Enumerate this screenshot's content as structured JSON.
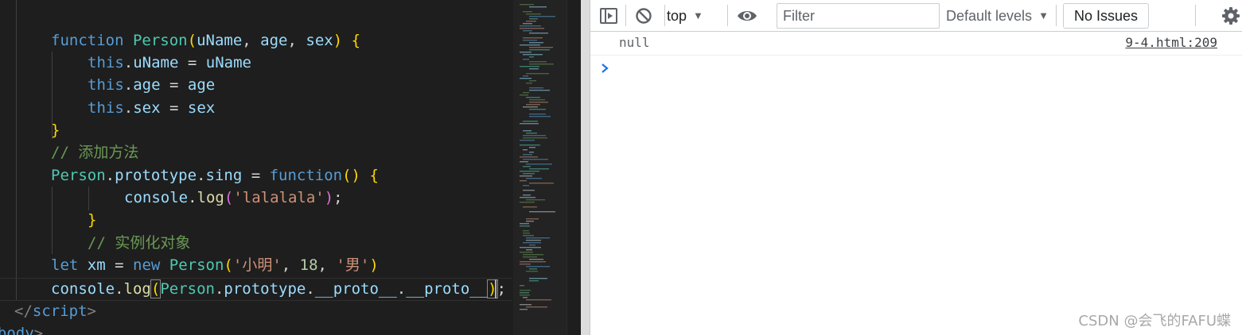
{
  "editor": {
    "code_lines": {
      "l1": {
        "kw": "function",
        "name": "Person",
        "open": "(",
        "p1": "uName",
        "c1": ", ",
        "p2": "age",
        "c2": ", ",
        "p3": "sex",
        "close": ")",
        "sp": " ",
        "brace": "{"
      },
      "l2": {
        "this": "this",
        "dot": ".",
        "prop": "uName",
        "eq": " = ",
        "val": "uName"
      },
      "l3": {
        "this": "this",
        "dot": ".",
        "prop": "age",
        "eq": " = ",
        "val": "age"
      },
      "l4": {
        "this": "this",
        "dot": ".",
        "prop": "sex",
        "eq": " = ",
        "val": "sex"
      },
      "l5": {
        "brace": "}"
      },
      "l6": {
        "comment": "// 添加方法"
      },
      "l7": {
        "cls": "Person",
        "dot1": ".",
        "proto": "prototype",
        "dot2": ".",
        "method": "sing",
        "eq": " = ",
        "kw": "function",
        "paren": "()",
        "sp": " ",
        "brace": "{"
      },
      "l8": {
        "obj": "console",
        "dot": ".",
        "fn": "log",
        "open": "(",
        "str": "'lalalala'",
        "close": ")",
        "semi": ";"
      },
      "l9": {
        "brace": "}"
      },
      "l10": {
        "comment": "// 实例化对象"
      },
      "l11": {
        "kw1": "let",
        "sp1": " ",
        "var": "xm",
        "eq": " = ",
        "kw2": "new",
        "sp2": " ",
        "cls": "Person",
        "open": "(",
        "s1": "'小明'",
        "c1": ", ",
        "num": "18",
        "c2": ", ",
        "s2": "'男'",
        "close": ")"
      },
      "l12": {
        "obj": "console",
        "dot": ".",
        "fn": "log",
        "open": "(",
        "cls": "Person",
        "dot1": ".",
        "proto": "prototype",
        "dot2": ".",
        "p1": "__proto__",
        "dot3": ".",
        "p2": "__proto__",
        "close": ")",
        "semi": ";"
      },
      "l13": {
        "lt": "</",
        "tag": "script",
        "gt": ">"
      },
      "l14": {
        "lt": "</",
        "tag": "body",
        "gt": ">"
      }
    }
  },
  "devtools": {
    "toolbar": {
      "sidebar_icon": "sidebar-toggle-icon",
      "clear_icon": "clear-console-icon",
      "context_label": "top",
      "context_arrow": "▼",
      "eye_icon": "eye-icon",
      "filter_placeholder": "Filter",
      "levels_label": "Default levels",
      "levels_arrow": "▼",
      "issues_label": "No Issues",
      "settings_icon": "gear-icon"
    },
    "messages": [
      {
        "text": "null",
        "source": "9-4.html:209"
      }
    ],
    "prompt_icon": "chevron-right-icon"
  },
  "watermark": "CSDN @会飞的FAFU蝶",
  "colors": {
    "editor_bg": "#1e1e1e",
    "keyword": "#569cd6",
    "function": "#dcdcaa",
    "class": "#4ec9b0",
    "variable": "#9cdcfe",
    "string": "#ce9178",
    "number": "#b5cea8",
    "comment": "#6a9955",
    "prompt_accent": "#1a73e8"
  }
}
